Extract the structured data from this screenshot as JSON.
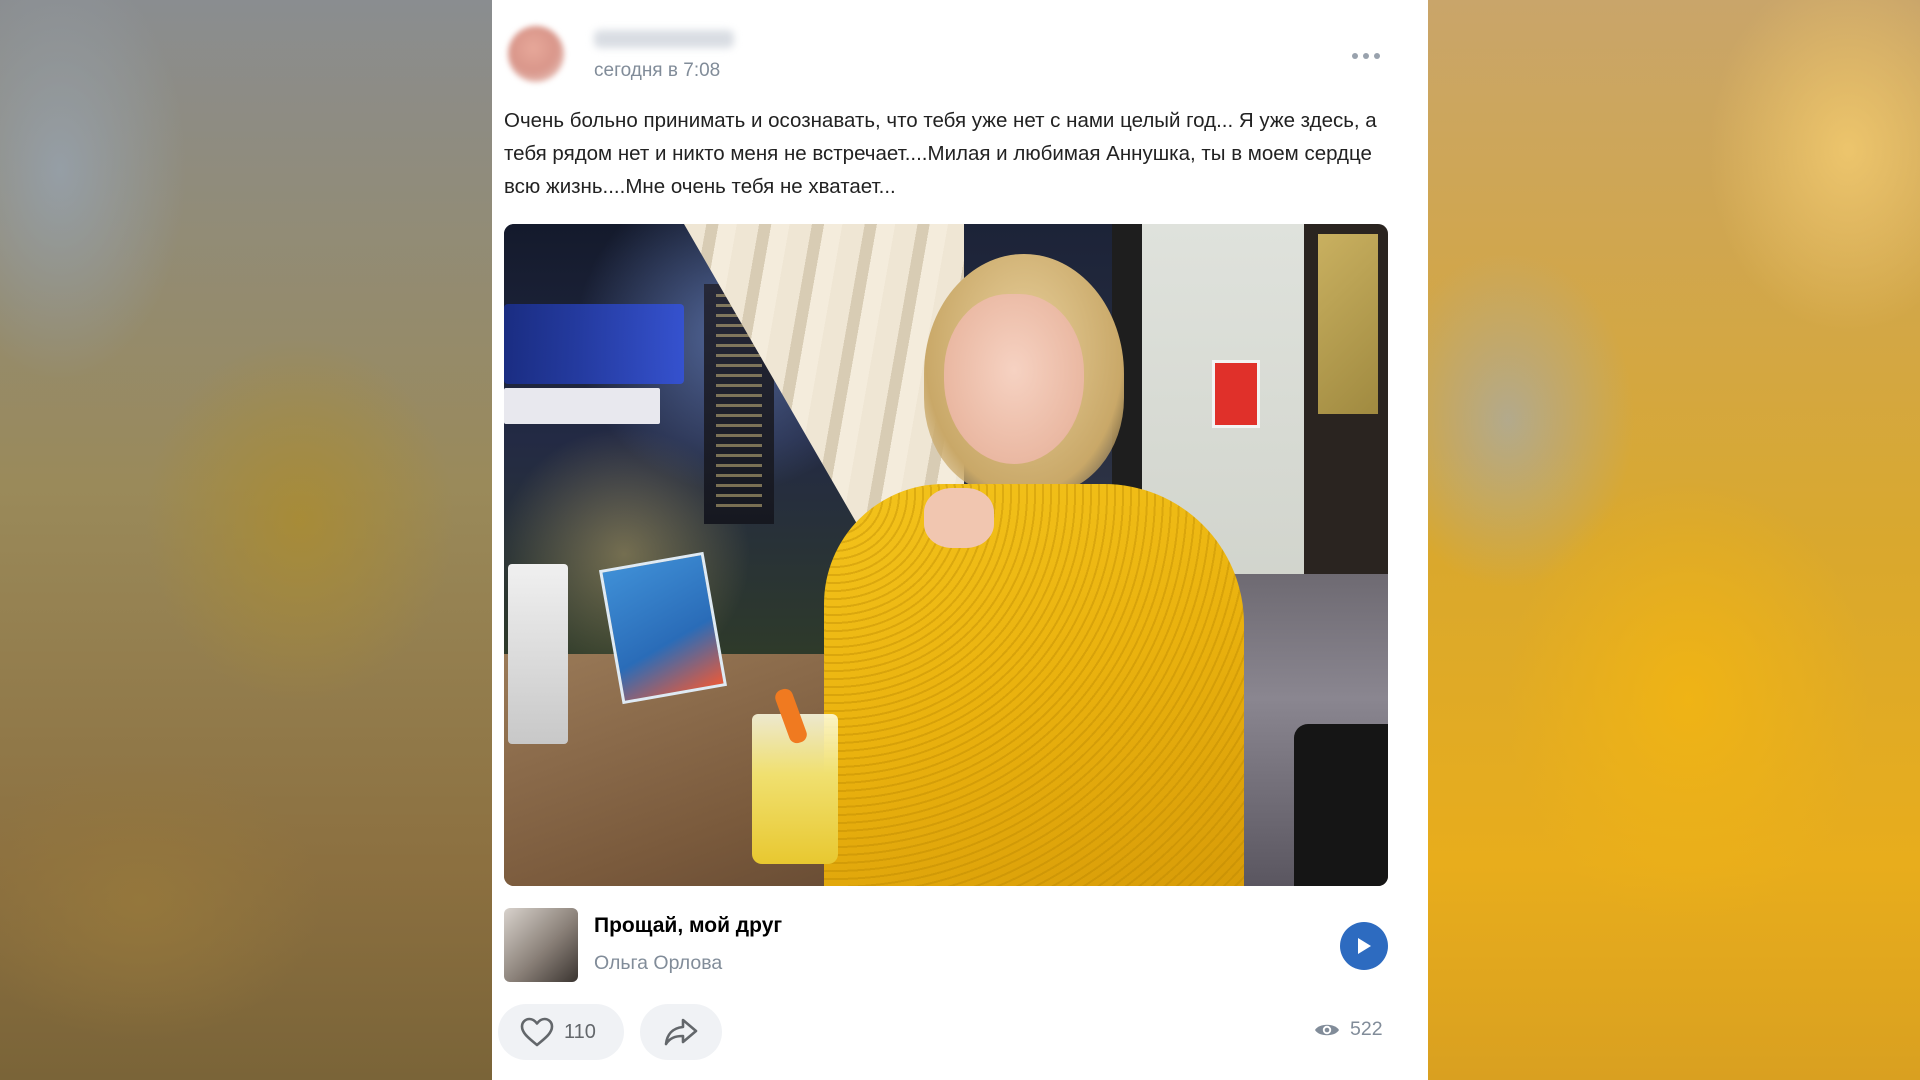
{
  "post": {
    "time": "сегодня в 7:08",
    "text": "Очень больно принимать и осознавать, что тебя уже нет с нами целый год... Я уже здесь, а тебя рядом нет и никто меня не встречает....Милая и любимая Аннушка, ты в моем сердце всю жизнь....Мне очень тебя не хватает...",
    "more_icon": "more-horizontal-icon"
  },
  "audio": {
    "title": "Прощай, мой друг",
    "artist": "Ольга Орлова",
    "play_icon": "play-icon"
  },
  "actions": {
    "likes": "110",
    "like_icon": "heart-icon",
    "share_icon": "share-icon",
    "views": "522",
    "views_icon": "eye-icon"
  },
  "colors": {
    "accent": "#2d6bc0",
    "secondary_text": "#818c99",
    "button_bg": "#f0f2f5"
  }
}
